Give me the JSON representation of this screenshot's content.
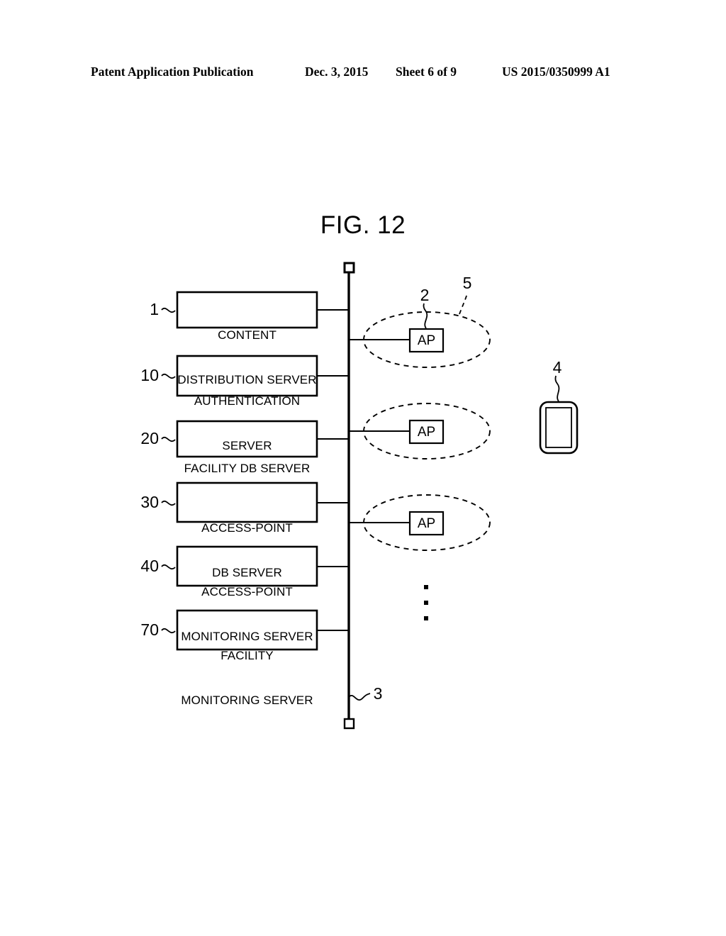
{
  "header": {
    "publication": "Patent Application Publication",
    "date": "Dec. 3, 2015",
    "sheet": "Sheet 6 of 9",
    "number": "US 2015/0350999 A1"
  },
  "figure": {
    "title": "FIG. 12",
    "line_color": "#000000",
    "background_color": "#ffffff"
  },
  "servers": [
    {
      "ref": "1",
      "line1": "CONTENT",
      "line2": "DISTRIBUTION SERVER"
    },
    {
      "ref": "10",
      "line1": "AUTHENTICATION",
      "line2": "SERVER"
    },
    {
      "ref": "20",
      "line1": "FACILITY DB SERVER",
      "line2": ""
    },
    {
      "ref": "30",
      "line1": "ACCESS-POINT",
      "line2": "DB SERVER"
    },
    {
      "ref": "40",
      "line1": "ACCESS-POINT",
      "line2": "MONITORING SERVER"
    },
    {
      "ref": "70",
      "line1": "FACILITY",
      "line2": "MONITORING SERVER"
    }
  ],
  "access_points": [
    {
      "label": "AP",
      "ref": "2",
      "area_ref": "5"
    },
    {
      "label": "AP",
      "ref": "",
      "area_ref": ""
    },
    {
      "label": "AP",
      "ref": "",
      "area_ref": ""
    }
  ],
  "network": {
    "ref": "3"
  },
  "mobile_terminal": {
    "ref": "4"
  },
  "continuation": {
    "symbol": "vertical-ellipsis"
  }
}
